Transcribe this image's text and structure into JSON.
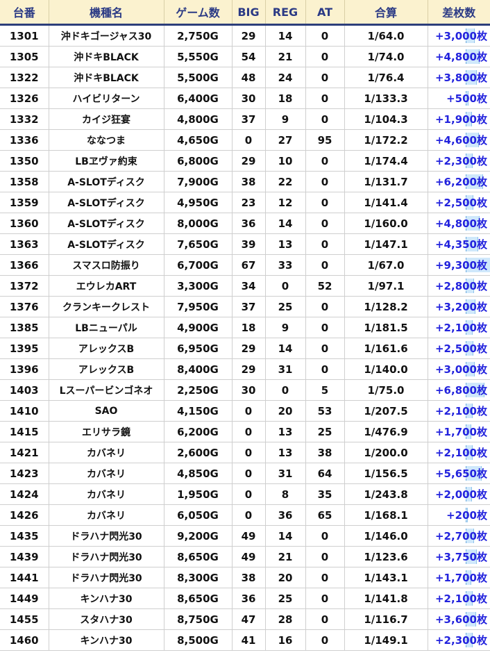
{
  "table": {
    "headers": {
      "no": "台番",
      "name": "機種名",
      "games": "ゲーム数",
      "big": "BIG",
      "reg": "REG",
      "at": "AT",
      "rate": "合算",
      "diff": "差枚数"
    },
    "rows": [
      {
        "no": "1301",
        "name": "沖ドキゴージャス30",
        "games": "2,750G",
        "big": "29",
        "reg": "14",
        "at": "0",
        "rate": "1/64.0",
        "diff": "+3,000枚",
        "diff_value": 3000
      },
      {
        "no": "1305",
        "name": "沖ドキBLACK",
        "games": "5,550G",
        "big": "54",
        "reg": "21",
        "at": "0",
        "rate": "1/74.0",
        "diff": "+4,800枚",
        "diff_value": 4800
      },
      {
        "no": "1322",
        "name": "沖ドキBLACK",
        "games": "5,500G",
        "big": "48",
        "reg": "24",
        "at": "0",
        "rate": "1/76.4",
        "diff": "+3,800枚",
        "diff_value": 3800
      },
      {
        "no": "1326",
        "name": "ハイビリターン",
        "games": "6,400G",
        "big": "30",
        "reg": "18",
        "at": "0",
        "rate": "1/133.3",
        "diff": "+500枚",
        "diff_value": 500
      },
      {
        "no": "1332",
        "name": "カイジ狂宴",
        "games": "4,800G",
        "big": "37",
        "reg": "9",
        "at": "0",
        "rate": "1/104.3",
        "diff": "+1,900枚",
        "diff_value": 1900
      },
      {
        "no": "1336",
        "name": "ななつま",
        "games": "4,650G",
        "big": "0",
        "reg": "27",
        "at": "95",
        "rate": "1/172.2",
        "diff": "+4,600枚",
        "diff_value": 4600
      },
      {
        "no": "1350",
        "name": "LBヱヴァ約束",
        "games": "6,800G",
        "big": "29",
        "reg": "10",
        "at": "0",
        "rate": "1/174.4",
        "diff": "+2,300枚",
        "diff_value": 2300
      },
      {
        "no": "1358",
        "name": "A-SLOTディスク",
        "games": "7,900G",
        "big": "38",
        "reg": "22",
        "at": "0",
        "rate": "1/131.7",
        "diff": "+6,200枚",
        "diff_value": 6200
      },
      {
        "no": "1359",
        "name": "A-SLOTディスク",
        "games": "4,950G",
        "big": "23",
        "reg": "12",
        "at": "0",
        "rate": "1/141.4",
        "diff": "+2,500枚",
        "diff_value": 2500
      },
      {
        "no": "1360",
        "name": "A-SLOTディスク",
        "games": "8,000G",
        "big": "36",
        "reg": "14",
        "at": "0",
        "rate": "1/160.0",
        "diff": "+4,800枚",
        "diff_value": 4800
      },
      {
        "no": "1363",
        "name": "A-SLOTディスク",
        "games": "7,650G",
        "big": "39",
        "reg": "13",
        "at": "0",
        "rate": "1/147.1",
        "diff": "+4,350枚",
        "diff_value": 4350
      },
      {
        "no": "1366",
        "name": "スマスロ防振り",
        "games": "6,700G",
        "big": "67",
        "reg": "33",
        "at": "0",
        "rate": "1/67.0",
        "diff": "+9,300枚",
        "diff_value": 9300
      },
      {
        "no": "1372",
        "name": "エウレカART",
        "games": "3,300G",
        "big": "34",
        "reg": "0",
        "at": "52",
        "rate": "1/97.1",
        "diff": "+2,800枚",
        "diff_value": 2800
      },
      {
        "no": "1376",
        "name": "クランキークレスト",
        "games": "7,950G",
        "big": "37",
        "reg": "25",
        "at": "0",
        "rate": "1/128.2",
        "diff": "+3,200枚",
        "diff_value": 3200
      },
      {
        "no": "1385",
        "name": "LBニューパル",
        "games": "4,900G",
        "big": "18",
        "reg": "9",
        "at": "0",
        "rate": "1/181.5",
        "diff": "+2,100枚",
        "diff_value": 2100
      },
      {
        "no": "1395",
        "name": "アレックスB",
        "games": "6,950G",
        "big": "29",
        "reg": "14",
        "at": "0",
        "rate": "1/161.6",
        "diff": "+2,500枚",
        "diff_value": 2500
      },
      {
        "no": "1396",
        "name": "アレックスB",
        "games": "8,400G",
        "big": "29",
        "reg": "31",
        "at": "0",
        "rate": "1/140.0",
        "diff": "+3,000枚",
        "diff_value": 3000
      },
      {
        "no": "1403",
        "name": "Lスーパービンゴネオ",
        "games": "2,250G",
        "big": "30",
        "reg": "0",
        "at": "5",
        "rate": "1/75.0",
        "diff": "+6,800枚",
        "diff_value": 6800
      },
      {
        "no": "1410",
        "name": "SAO",
        "games": "4,150G",
        "big": "0",
        "reg": "20",
        "at": "53",
        "rate": "1/207.5",
        "diff": "+2,100枚",
        "diff_value": 2100
      },
      {
        "no": "1415",
        "name": "エリサラ鏡",
        "games": "6,200G",
        "big": "0",
        "reg": "13",
        "at": "25",
        "rate": "1/476.9",
        "diff": "+1,700枚",
        "diff_value": 1700
      },
      {
        "no": "1421",
        "name": "カバネリ",
        "games": "2,600G",
        "big": "0",
        "reg": "13",
        "at": "38",
        "rate": "1/200.0",
        "diff": "+2,100枚",
        "diff_value": 2100
      },
      {
        "no": "1423",
        "name": "カバネリ",
        "games": "4,850G",
        "big": "0",
        "reg": "31",
        "at": "64",
        "rate": "1/156.5",
        "diff": "+5,650枚",
        "diff_value": 5650
      },
      {
        "no": "1424",
        "name": "カバネリ",
        "games": "1,950G",
        "big": "0",
        "reg": "8",
        "at": "35",
        "rate": "1/243.8",
        "diff": "+2,000枚",
        "diff_value": 2000
      },
      {
        "no": "1426",
        "name": "カバネリ",
        "games": "6,050G",
        "big": "0",
        "reg": "36",
        "at": "65",
        "rate": "1/168.1",
        "diff": "+200枚",
        "diff_value": 200
      },
      {
        "no": "1435",
        "name": "ドラハナ閃光30",
        "games": "9,200G",
        "big": "49",
        "reg": "14",
        "at": "0",
        "rate": "1/146.0",
        "diff": "+2,700枚",
        "diff_value": 2700
      },
      {
        "no": "1439",
        "name": "ドラハナ閃光30",
        "games": "8,650G",
        "big": "49",
        "reg": "21",
        "at": "0",
        "rate": "1/123.6",
        "diff": "+3,750枚",
        "diff_value": 3750
      },
      {
        "no": "1441",
        "name": "ドラハナ閃光30",
        "games": "8,300G",
        "big": "38",
        "reg": "20",
        "at": "0",
        "rate": "1/143.1",
        "diff": "+1,700枚",
        "diff_value": 1700
      },
      {
        "no": "1449",
        "name": "キンハナ30",
        "games": "8,650G",
        "big": "36",
        "reg": "25",
        "at": "0",
        "rate": "1/141.8",
        "diff": "+2,100枚",
        "diff_value": 2100
      },
      {
        "no": "1455",
        "name": "スタハナ30",
        "games": "8,750G",
        "big": "47",
        "reg": "28",
        "at": "0",
        "rate": "1/116.7",
        "diff": "+3,600枚",
        "diff_value": 3600
      },
      {
        "no": "1460",
        "name": "キンハナ30",
        "games": "8,500G",
        "big": "41",
        "reg": "16",
        "at": "0",
        "rate": "1/149.1",
        "diff": "+2,300枚",
        "diff_value": 2300
      }
    ],
    "diff_max": 9300
  },
  "colors": {
    "header_bg": "#fbf2cf",
    "header_text": "#2b3a85",
    "header_rule": "#2c3e7a",
    "diff_text": "#2222dd",
    "bar_fill": "#cfe8fb"
  }
}
